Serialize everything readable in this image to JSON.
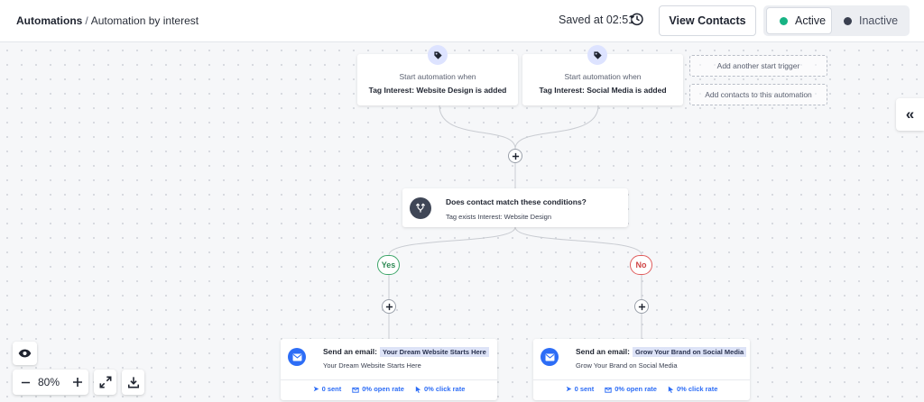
{
  "header": {
    "breadcrumb_root": "Automations",
    "breadcrumb_separator": "/",
    "breadcrumb_current": "Automation by interest",
    "saved_text": "Saved at 02:51",
    "history_icon": "history-icon",
    "view_contacts_label": "View Contacts",
    "status": {
      "active_label": "Active",
      "inactive_label": "Inactive",
      "selected": "Active",
      "active_color": "#17b384",
      "inactive_color": "#3a4050"
    }
  },
  "triggers": [
    {
      "icon": "tag-icon",
      "line1": "Start automation when",
      "line2": "Tag Interest: Website Design is added"
    },
    {
      "icon": "tag-icon",
      "line1": "Start automation when",
      "line2": "Tag Interest: Social Media is added"
    }
  ],
  "side_actions": {
    "add_trigger_label": "Add another start trigger",
    "add_contacts_label": "Add contacts to this automation"
  },
  "condition": {
    "icon": "branch-icon",
    "title": "Does contact match these conditions?",
    "detail": "Tag exists Interest: Website Design"
  },
  "branches": {
    "yes_label": "Yes",
    "no_label": "No",
    "yes_color": "#3ea66a",
    "no_color": "#e05c5c"
  },
  "emails": [
    {
      "label": "Send an email:",
      "subject": "Your Dream Website Starts Here",
      "preview": "Your Dream Website Starts Here",
      "stats": {
        "sent": "0 sent",
        "open_rate": "0% open rate",
        "click_rate": "0% click rate"
      }
    },
    {
      "label": "Send an email:",
      "subject": "Grow Your Brand on Social Media",
      "preview": "Grow Your Brand on Social Media",
      "stats": {
        "sent": "0 sent",
        "open_rate": "0% open rate",
        "click_rate": "0% click rate"
      }
    }
  ],
  "controls": {
    "zoom_level": "80%",
    "accent_color": "#2d6df6"
  }
}
